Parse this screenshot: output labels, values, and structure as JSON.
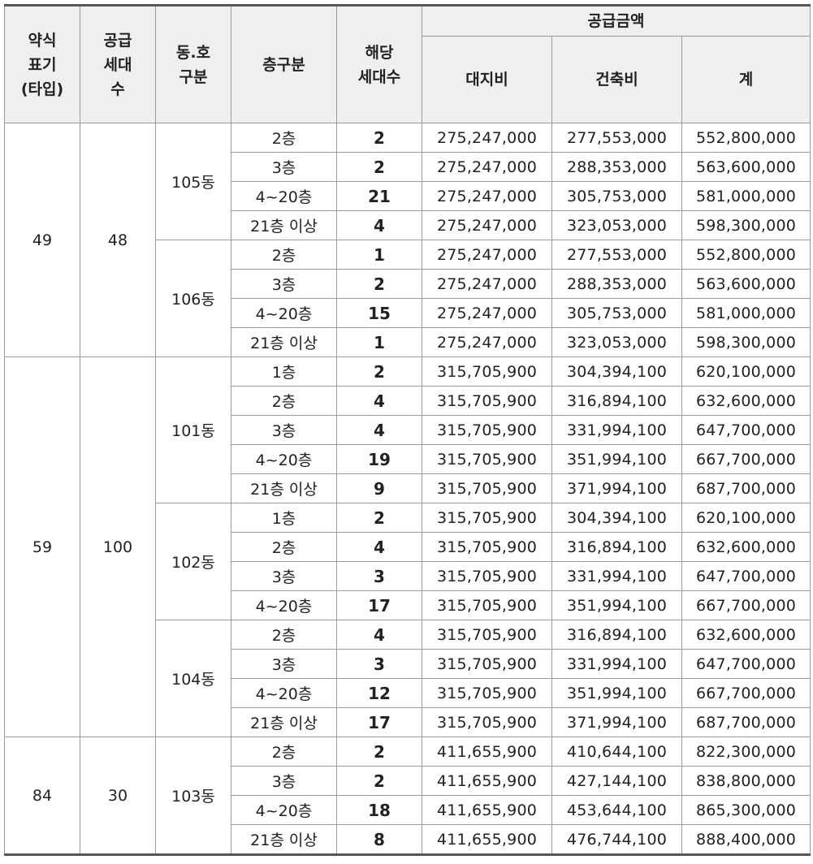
{
  "headers": {
    "type": [
      "약식",
      "표기",
      "(타입)"
    ],
    "supply": [
      "공급",
      "세대",
      "수"
    ],
    "dong": [
      "동.호",
      "구분"
    ],
    "floor": "층구분",
    "count": [
      "해당",
      "세대수"
    ],
    "amount_group": "공급금액",
    "land": "대지비",
    "building": "건축비",
    "total": "계"
  },
  "type_groups": [
    {
      "type": "49",
      "supply": "48",
      "dongs": [
        {
          "name": "105동",
          "rows": [
            {
              "floor": "2층",
              "count": "2",
              "land": "275,247,000",
              "building": "277,553,000",
              "total": "552,800,000"
            },
            {
              "floor": "3층",
              "count": "2",
              "land": "275,247,000",
              "building": "288,353,000",
              "total": "563,600,000"
            },
            {
              "floor": "4~20층",
              "count": "21",
              "land": "275,247,000",
              "building": "305,753,000",
              "total": "581,000,000"
            },
            {
              "floor": "21층 이상",
              "count": "4",
              "land": "275,247,000",
              "building": "323,053,000",
              "total": "598,300,000"
            }
          ]
        },
        {
          "name": "106동",
          "rows": [
            {
              "floor": "2층",
              "count": "1",
              "land": "275,247,000",
              "building": "277,553,000",
              "total": "552,800,000"
            },
            {
              "floor": "3층",
              "count": "2",
              "land": "275,247,000",
              "building": "288,353,000",
              "total": "563,600,000"
            },
            {
              "floor": "4~20층",
              "count": "15",
              "land": "275,247,000",
              "building": "305,753,000",
              "total": "581,000,000"
            },
            {
              "floor": "21층 이상",
              "count": "1",
              "land": "275,247,000",
              "building": "323,053,000",
              "total": "598,300,000"
            }
          ]
        }
      ]
    },
    {
      "type": "59",
      "supply": "100",
      "dongs": [
        {
          "name": "101동",
          "rows": [
            {
              "floor": "1층",
              "count": "2",
              "land": "315,705,900",
              "building": "304,394,100",
              "total": "620,100,000"
            },
            {
              "floor": "2층",
              "count": "4",
              "land": "315,705,900",
              "building": "316,894,100",
              "total": "632,600,000"
            },
            {
              "floor": "3층",
              "count": "4",
              "land": "315,705,900",
              "building": "331,994,100",
              "total": "647,700,000"
            },
            {
              "floor": "4~20층",
              "count": "19",
              "land": "315,705,900",
              "building": "351,994,100",
              "total": "667,700,000"
            },
            {
              "floor": "21층 이상",
              "count": "9",
              "land": "315,705,900",
              "building": "371,994,100",
              "total": "687,700,000"
            }
          ]
        },
        {
          "name": "102동",
          "rows": [
            {
              "floor": "1층",
              "count": "2",
              "land": "315,705,900",
              "building": "304,394,100",
              "total": "620,100,000"
            },
            {
              "floor": "2층",
              "count": "4",
              "land": "315,705,900",
              "building": "316,894,100",
              "total": "632,600,000"
            },
            {
              "floor": "3층",
              "count": "3",
              "land": "315,705,900",
              "building": "331,994,100",
              "total": "647,700,000"
            },
            {
              "floor": "4~20층",
              "count": "17",
              "land": "315,705,900",
              "building": "351,994,100",
              "total": "667,700,000"
            }
          ]
        },
        {
          "name": "104동",
          "rows": [
            {
              "floor": "2층",
              "count": "4",
              "land": "315,705,900",
              "building": "316,894,100",
              "total": "632,600,000"
            },
            {
              "floor": "3층",
              "count": "3",
              "land": "315,705,900",
              "building": "331,994,100",
              "total": "647,700,000"
            },
            {
              "floor": "4~20층",
              "count": "12",
              "land": "315,705,900",
              "building": "351,994,100",
              "total": "667,700,000"
            },
            {
              "floor": "21층 이상",
              "count": "17",
              "land": "315,705,900",
              "building": "371,994,100",
              "total": "687,700,000"
            }
          ]
        }
      ]
    },
    {
      "type": "84",
      "supply": "30",
      "dongs": [
        {
          "name": "103동",
          "rows": [
            {
              "floor": "2층",
              "count": "2",
              "land": "411,655,900",
              "building": "410,644,100",
              "total": "822,300,000"
            },
            {
              "floor": "3층",
              "count": "2",
              "land": "411,655,900",
              "building": "427,144,100",
              "total": "838,800,000"
            },
            {
              "floor": "4~20층",
              "count": "18",
              "land": "411,655,900",
              "building": "453,644,100",
              "total": "865,300,000"
            },
            {
              "floor": "21층 이상",
              "count": "8",
              "land": "411,655,900",
              "building": "476,744,100",
              "total": "888,400,000"
            }
          ]
        }
      ]
    }
  ]
}
